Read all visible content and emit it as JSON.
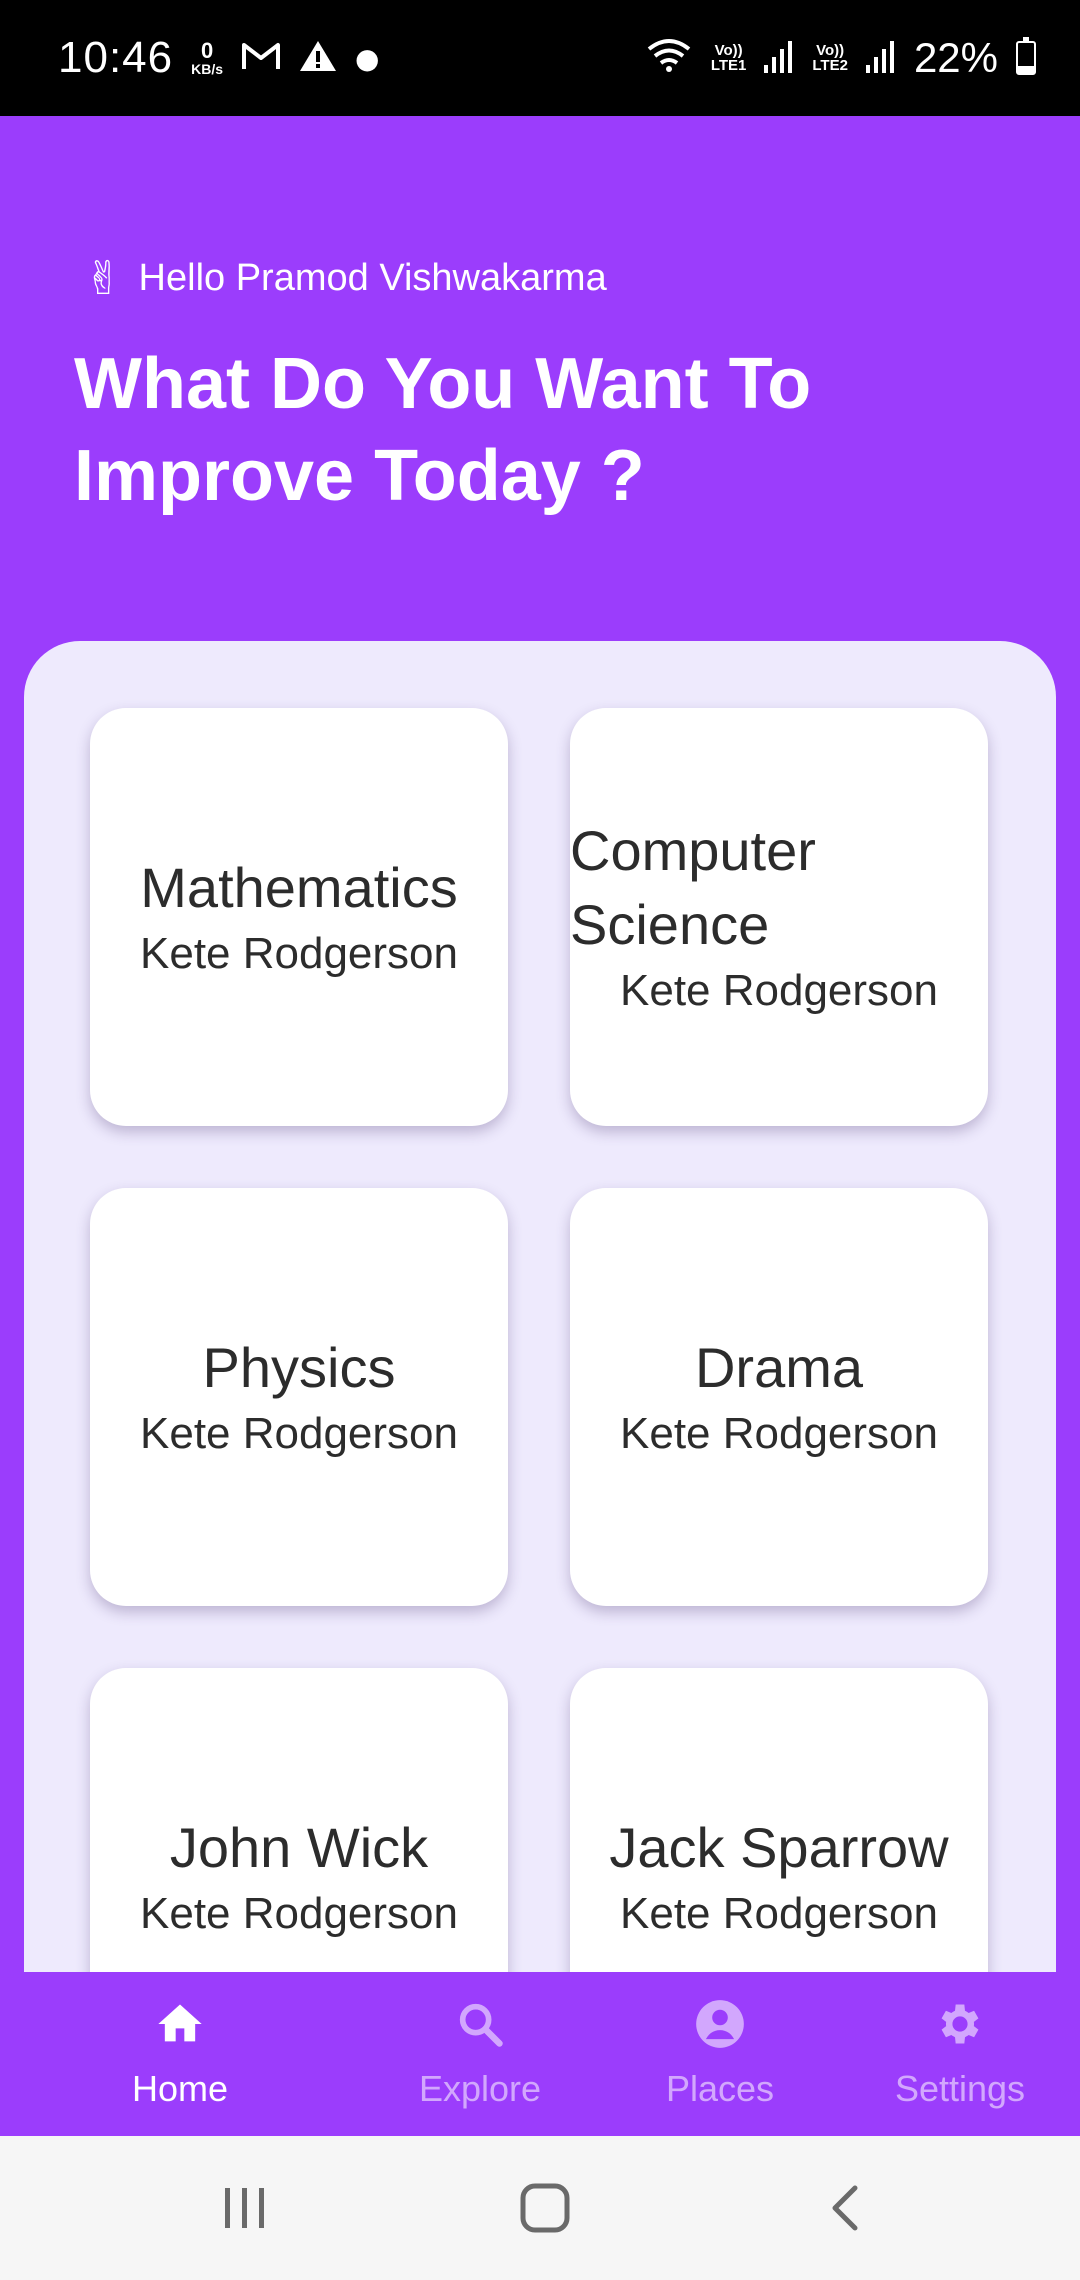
{
  "status": {
    "time": "10:46",
    "speed_value": "0",
    "speed_unit": "KB/s",
    "network1": [
      "Vo))",
      "LTE1"
    ],
    "network2": [
      "Vo))",
      "LTE2"
    ],
    "battery": "22%",
    "battery_level": 0.22
  },
  "header": {
    "greeting": "Hello Pramod Vishwakarma",
    "headline_line1": "What Do You Want To",
    "headline_line2": "Improve Today ?"
  },
  "courses": [
    {
      "subject": "Mathematics",
      "teacher": "Kete Rodgerson"
    },
    {
      "subject": "Computer Science",
      "teacher": "Kete Rodgerson"
    },
    {
      "subject": "Physics",
      "teacher": "Kete Rodgerson"
    },
    {
      "subject": "Drama",
      "teacher": "Kete Rodgerson"
    },
    {
      "subject": "John Wick",
      "teacher": "Kete Rodgerson"
    },
    {
      "subject": "Jack Sparrow",
      "teacher": "Kete Rodgerson"
    }
  ],
  "nav": {
    "items": [
      {
        "label": "Home",
        "icon": "home-icon",
        "active": true
      },
      {
        "label": "Explore",
        "icon": "search-icon",
        "active": false
      },
      {
        "label": "Places",
        "icon": "account-icon",
        "active": false
      },
      {
        "label": "Settings",
        "icon": "gear-icon",
        "active": false
      }
    ]
  },
  "colors": {
    "primary": "#9b3dfc",
    "panel": "#eeeafd",
    "card": "#ffffff",
    "text": "#2c2c2c"
  }
}
